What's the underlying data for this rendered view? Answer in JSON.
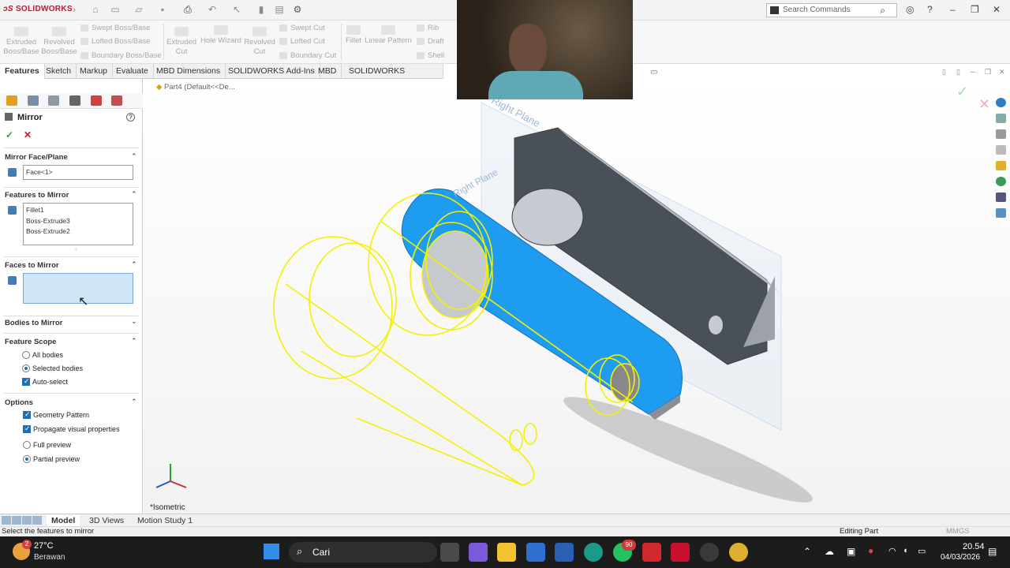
{
  "titlebar": {
    "app_name": "SOLIDWORKS",
    "search_placeholder": "Search Commands"
  },
  "commands": {
    "extruded_boss": "Extruded Boss/Base",
    "revolved_boss": "Revolved Boss/Base",
    "swept_boss": "Swept Boss/Base",
    "lofted_boss": "Lofted Boss/Base",
    "boundary_boss": "Boundary Boss/Base",
    "extruded_cut": "Extruded Cut",
    "hole_wizard": "Hole Wizard",
    "revolved_cut": "Revolved Cut",
    "swept_cut": "Swept Cut",
    "lofted_cut": "Lofted Cut",
    "boundary_cut": "Boundary Cut",
    "fillet": "Fillet",
    "linear_pattern": "Linear Pattern",
    "rib": "Rib",
    "draft": "Draft",
    "shell": "Shell"
  },
  "tabs": [
    "Features",
    "Sketch",
    "Markup",
    "Evaluate",
    "MBD Dimensions",
    "SOLIDWORKS Add-Ins",
    "MBD",
    "SOLIDWORKS Inspection"
  ],
  "pm": {
    "title": "Mirror",
    "mirror_face_plane": "Mirror Face/Plane",
    "face_value": "Face<1>",
    "features_to_mirror": "Features to Mirror",
    "features": [
      "Fillet1",
      "Boss-Extrude3",
      "Boss-Extrude2"
    ],
    "faces_to_mirror": "Faces to Mirror",
    "bodies_to_mirror": "Bodies to Mirror",
    "feature_scope": "Feature Scope",
    "all_bodies": "All bodies",
    "selected_bodies": "Selected bodies",
    "auto_select": "Auto-select",
    "options": "Options",
    "geometry_pattern": "Geometry Pattern",
    "propagate_visual": "Propagate visual properties",
    "full_preview": "Full preview",
    "partial_preview": "Partial preview"
  },
  "viewport": {
    "tree_root": "Part4  (Default<<De...",
    "right_plane": "Right Plane",
    "view_name": "*Isometric"
  },
  "bottom_tabs": [
    "Model",
    "3D Views",
    "Motion Study 1"
  ],
  "status": {
    "message": "Select the features to mirror",
    "mode": "Editing Part",
    "units": "MMGS"
  },
  "taskbar": {
    "temperature": "27°C",
    "weather": "Berawan",
    "weather_badge": "2",
    "search": "Cari",
    "whatsapp_badge": "90",
    "time": "20.54",
    "date": "04/03/2026"
  },
  "colors": {
    "selected_face": "#1e9cf0",
    "preview": "#f2f200",
    "accent_red": "#c8102e"
  }
}
